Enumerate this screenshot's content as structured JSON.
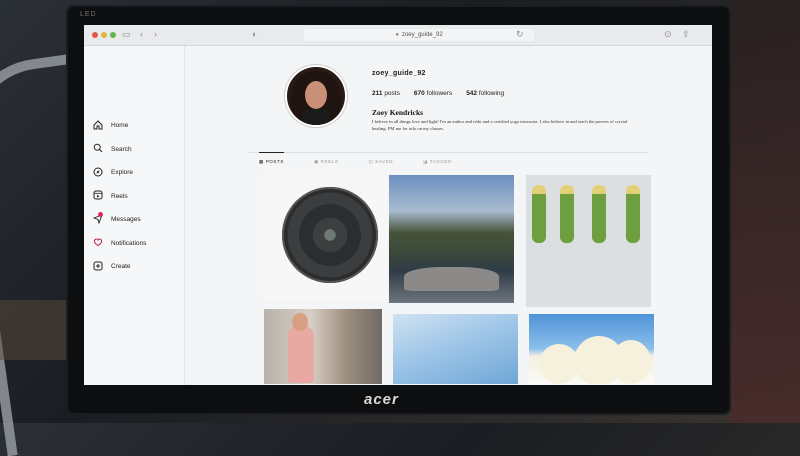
{
  "monitor": {
    "brand": "acer",
    "top_label": "LED"
  },
  "browser": {
    "url": "zoey_guide_92",
    "icons": [
      "sidebar-icon",
      "back-icon",
      "forward-icon",
      "shield-icon",
      "lock-icon",
      "reload-icon",
      "download-icon",
      "share-icon"
    ]
  },
  "sidebar": {
    "items": [
      {
        "label": "Home",
        "icon": "home-icon"
      },
      {
        "label": "Search",
        "icon": "search-icon"
      },
      {
        "label": "Explore",
        "icon": "compass-icon"
      },
      {
        "label": "Reels",
        "icon": "reels-icon"
      },
      {
        "label": "Messages",
        "icon": "messages-icon"
      },
      {
        "label": "Notifications",
        "icon": "heart-icon"
      },
      {
        "label": "Create",
        "icon": "plus-icon"
      }
    ]
  },
  "profile": {
    "username": "zoey_guide_92",
    "posts": "211",
    "posts_label": "posts",
    "followers": "670",
    "followers_label": "followers",
    "following": "542",
    "following_label": "following",
    "full_name": "Zoey Kendricks",
    "bio": "I believe in all things love and light! I'm an author and reiki and a certified yoga instructor. I also believe in and teach the powers of crystal healing. PM me for info on my classes."
  },
  "tabs": [
    {
      "label": "POSTS",
      "active": true
    },
    {
      "label": "REELS",
      "active": false
    },
    {
      "label": "SAVED",
      "active": false
    },
    {
      "label": "TAGGED",
      "active": false
    }
  ],
  "colors": {
    "accent": "#e0245e",
    "text": "#222222",
    "background": "#f4f5f6"
  }
}
